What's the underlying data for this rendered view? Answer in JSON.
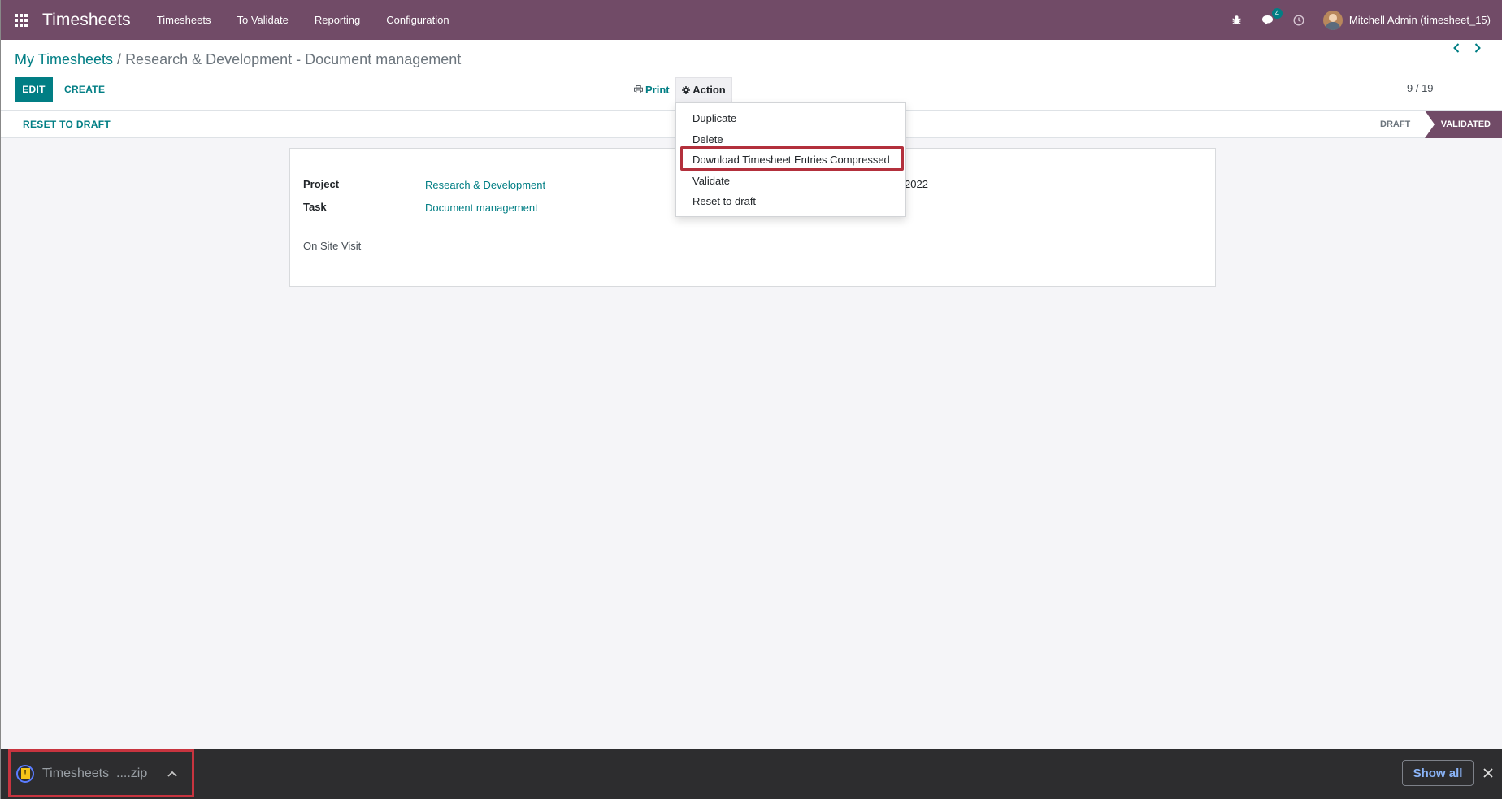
{
  "navbar": {
    "brand": "Timesheets",
    "menu": [
      "Timesheets",
      "To Validate",
      "Reporting",
      "Configuration"
    ],
    "messages_badge": "4",
    "user": "Mitchell Admin (timesheet_15)",
    "icons": [
      "apps-icon",
      "bug-icon",
      "chat-icon",
      "clock-icon"
    ]
  },
  "breadcrumb": {
    "parent": "My Timesheets",
    "separator": " / ",
    "current": "Research & Development - Document management"
  },
  "toolbar": {
    "edit_label": "EDIT",
    "create_label": "CREATE",
    "print_label": "Print",
    "action_label": "Action"
  },
  "pager": {
    "text": "9 / 19"
  },
  "statusbar": {
    "reset_label": "RESET TO DRAFT",
    "stages": [
      "DRAFT",
      "VALIDATED"
    ],
    "active_stage": "VALIDATED"
  },
  "form": {
    "project_label": "Project",
    "project_value": "Research & Development",
    "task_label": "Task",
    "task_value": "Document management",
    "description": "On Site Visit",
    "date_partial": "2022"
  },
  "action_menu": {
    "items": [
      "Duplicate",
      "Delete",
      "Download Timesheet Entries Compressed",
      "Validate",
      "Reset to draft"
    ],
    "highlighted": "Download Timesheet Entries Compressed"
  },
  "download_bar": {
    "file_name": "Timesheets_....zip",
    "show_all_label": "Show all"
  },
  "colors": {
    "brand": "#714b67",
    "accent": "#017e84",
    "highlight": "#b3303c"
  }
}
